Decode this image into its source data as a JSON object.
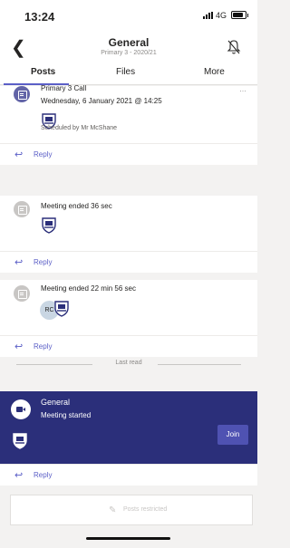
{
  "status_bar": {
    "time": "13:24",
    "network": "4G"
  },
  "header": {
    "title": "General",
    "subtitle": "Primary 3 - 2020/21"
  },
  "tabs": [
    "Posts",
    "Files",
    "More"
  ],
  "posts": [
    {
      "title": "Primary 3 Call",
      "datetime": "Wednesday, 6 January 2021 @ 14:25",
      "scheduled_by": "Scheduled by Mr McShane"
    },
    {
      "text": "Meeting ended  36 sec"
    },
    {
      "text": "Meeting ended  22 min 56 sec",
      "avatar_initials": "RC"
    }
  ],
  "reply_label": "Reply",
  "divider_label": "Last read",
  "meeting": {
    "title": "General",
    "status": "Meeting started",
    "join_label": "Join"
  },
  "restricted_label": "Posts restricted",
  "colors": {
    "accent": "#5b5fc7",
    "meeting_bg": "#2b2f7a",
    "join_button": "#4f52b2"
  }
}
